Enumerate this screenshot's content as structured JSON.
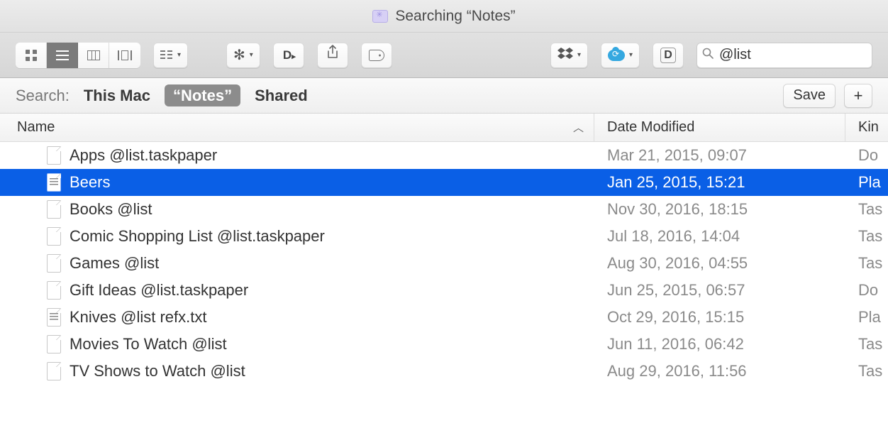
{
  "window": {
    "title": "Searching “Notes”"
  },
  "search": {
    "value": "@list"
  },
  "scopebar": {
    "label": "Search:",
    "options": [
      {
        "label": "This Mac",
        "selected": false
      },
      {
        "label": "“Notes”",
        "selected": true
      },
      {
        "label": "Shared",
        "selected": false
      }
    ],
    "save_label": "Save",
    "add_label": "+"
  },
  "columns": {
    "name": "Name",
    "date": "Date Modified",
    "kind": "Kin"
  },
  "rows": [
    {
      "name": "Apps @list.taskpaper",
      "date": "Mar 21, 2015, 09:07",
      "kind": "Do",
      "icon": "doc",
      "selected": false
    },
    {
      "name": "Beers",
      "date": "Jan 25, 2015, 15:21",
      "kind": "Pla",
      "icon": "text",
      "selected": true
    },
    {
      "name": "Books @list",
      "date": "Nov 30, 2016, 18:15",
      "kind": "Tas",
      "icon": "doc",
      "selected": false
    },
    {
      "name": "Comic Shopping List @list.taskpaper",
      "date": "Jul 18, 2016, 14:04",
      "kind": "Tas",
      "icon": "doc",
      "selected": false
    },
    {
      "name": "Games @list",
      "date": "Aug 30, 2016, 04:55",
      "kind": "Tas",
      "icon": "doc",
      "selected": false
    },
    {
      "name": "Gift Ideas @list.taskpaper",
      "date": "Jun 25, 2015, 06:57",
      "kind": "Do",
      "icon": "doc",
      "selected": false
    },
    {
      "name": "Knives @list refx.txt",
      "date": "Oct 29, 2016, 15:15",
      "kind": "Pla",
      "icon": "text",
      "selected": false
    },
    {
      "name": "Movies To Watch @list",
      "date": "Jun 11, 2016, 06:42",
      "kind": "Tas",
      "icon": "doc",
      "selected": false
    },
    {
      "name": "TV Shows to Watch @list",
      "date": "Aug 29, 2016, 11:56",
      "kind": "Tas",
      "icon": "doc",
      "selected": false
    }
  ]
}
